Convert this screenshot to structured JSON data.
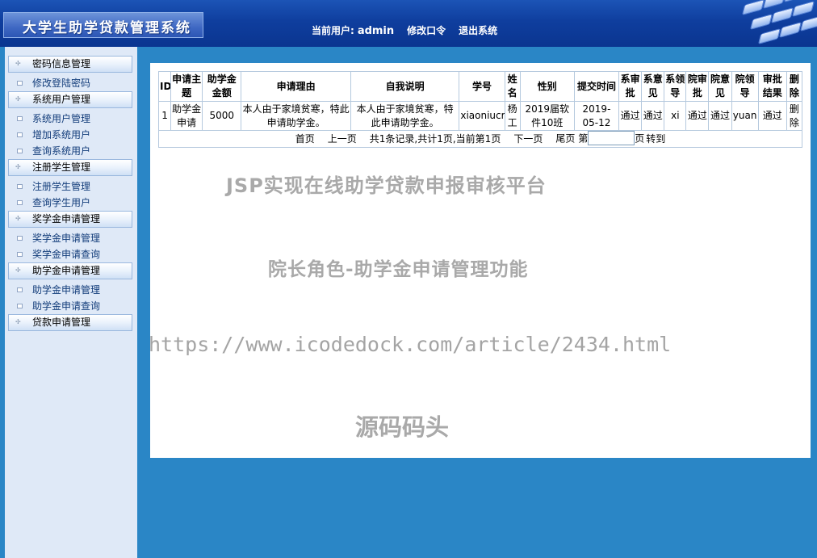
{
  "header": {
    "app_title": "大学生助学贷款管理系统",
    "current_user_label": "当前用户:",
    "current_user": "admin",
    "change_password": "修改口令",
    "logout": "退出系统"
  },
  "sidebar": {
    "groups": [
      {
        "title": "密码信息管理",
        "items": [
          "修改登陆密码"
        ]
      },
      {
        "title": "系统用户管理",
        "items": [
          "系统用户管理",
          "增加系统用户",
          "查询系统用户"
        ]
      },
      {
        "title": "注册学生管理",
        "items": [
          "注册学生管理",
          "查询学生用户"
        ]
      },
      {
        "title": "奖学金申请管理",
        "items": [
          "奖学金申请管理",
          "奖学金申请查询"
        ]
      },
      {
        "title": "助学金申请管理",
        "items": [
          "助学金申请管理",
          "助学金申请查询"
        ]
      },
      {
        "title": "贷款申请管理",
        "items": []
      }
    ]
  },
  "table": {
    "columns": [
      "ID",
      "申请主题",
      "助学金金额",
      "申请理由",
      "自我说明",
      "学号",
      "姓名",
      "性别",
      "提交时间",
      "系审批",
      "系意见",
      "系领导",
      "院审批",
      "院意见",
      "院领导",
      "审批结果",
      "删除"
    ],
    "rows": [
      [
        "1",
        "助学金申请",
        "5000",
        "本人由于家境贫寒，特此申请助学金。",
        "本人由于家境贫寒，特此申请助学金。",
        "xiaoniucr",
        "杨工",
        "2019届软件10班",
        "2019-05-12",
        "通过",
        "通过",
        "xi",
        "通过",
        "通过",
        "yuan",
        "通过",
        "删除"
      ]
    ]
  },
  "pager": {
    "first": "首页",
    "prev": "上一页",
    "summary": "共1条记录,共计1页,当前第1页",
    "next": "下一页",
    "last": "尾页",
    "page_prefix": "第",
    "page_input_value": "",
    "page_suffix": "页",
    "go": "转到"
  },
  "watermarks": {
    "line1": "JSP实现在线助学贷款申报审核平台",
    "line2": "院长角色-助学金申请管理功能",
    "line3": "https://www.icodedock.com/article/2434.html",
    "line4": "源码码头"
  },
  "colors": {
    "header_blue": "#0f3e9e",
    "content_blue": "#2a86c6",
    "sidebar_bg": "#dfe9f7",
    "table_border": "#b5c9de"
  }
}
